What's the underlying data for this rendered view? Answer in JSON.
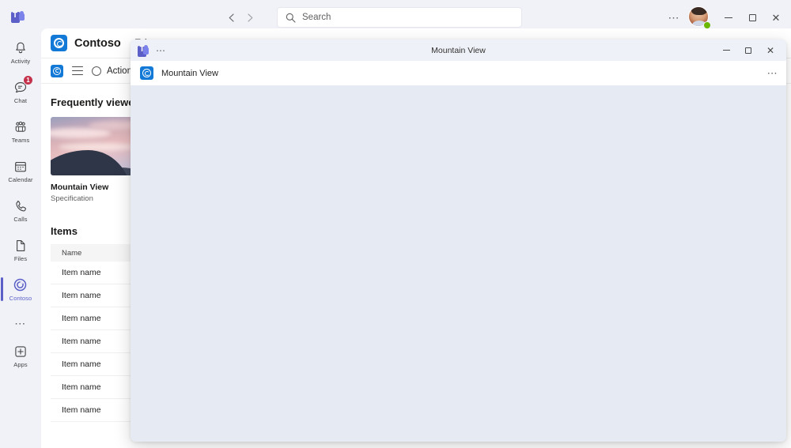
{
  "window": {
    "app_logo_icon": "teams-icon",
    "nav_back_icon": "chevron-left-icon",
    "nav_forward_icon": "chevron-right-icon",
    "search": {
      "placeholder": "Search",
      "value": "Search",
      "icon": "search-icon"
    },
    "more_icon": "ellipsis-icon",
    "avatar_icon": "avatar",
    "presence": "available",
    "minimize_label": "Minimize",
    "maximize_label": "Maximize",
    "close_label": "Close"
  },
  "rail": {
    "items": [
      {
        "label": "Activity",
        "icon": "bell-icon",
        "badge": "",
        "selected": false
      },
      {
        "label": "Chat",
        "icon": "chat-icon",
        "badge": "1",
        "selected": false
      },
      {
        "label": "Teams",
        "icon": "teams-people-icon",
        "badge": "",
        "selected": false
      },
      {
        "label": "Calendar",
        "icon": "calendar-icon",
        "badge": "",
        "selected": false
      },
      {
        "label": "Calls",
        "icon": "phone-icon",
        "badge": "",
        "selected": false
      },
      {
        "label": "Files",
        "icon": "file-icon",
        "badge": "",
        "selected": false
      },
      {
        "label": "Contoso",
        "icon": "contoso-icon",
        "badge": "",
        "selected": true
      }
    ],
    "more_icon": "ellipsis-icon",
    "apps": {
      "label": "Apps",
      "icon": "plus-box-icon"
    }
  },
  "app": {
    "logo_icon": "contoso-icon",
    "title": "Contoso",
    "tabs": [
      {
        "label": "Tab",
        "active": true
      }
    ],
    "toolbar": {
      "logo_icon": "contoso-icon",
      "menu_icon": "hamburger-icon",
      "action_icon": "circle-icon",
      "action_label": "Action"
    },
    "frequently_viewed": {
      "heading": "Frequently viewed",
      "cards": [
        {
          "title": "Mountain View",
          "subtitle": "Specification",
          "image": "mountain-sunset-thumbnail"
        }
      ]
    },
    "items": {
      "heading": "Items",
      "columns": [
        "Name"
      ],
      "rows": [
        {
          "name": "Item name"
        },
        {
          "name": "Item name"
        },
        {
          "name": "Item name"
        },
        {
          "name": "Item name"
        },
        {
          "name": "Item name"
        },
        {
          "name": "Item name"
        },
        {
          "name": "Item name"
        }
      ]
    }
  },
  "popup": {
    "teams_icon": "teams-icon",
    "more_icon": "ellipsis-icon",
    "title": "Mountain View",
    "minimize_label": "Minimize",
    "maximize_label": "Maximize",
    "close_label": "Close",
    "app_logo_icon": "contoso-icon",
    "app_title": "Mountain View",
    "app_more_icon": "ellipsis-icon"
  },
  "colors": {
    "accent": "#5b5fc7",
    "contoso_blue": "#1379d6",
    "badge_red": "#c4314b",
    "presence_green": "#6bb700",
    "popup_body": "#e5eaf3"
  }
}
